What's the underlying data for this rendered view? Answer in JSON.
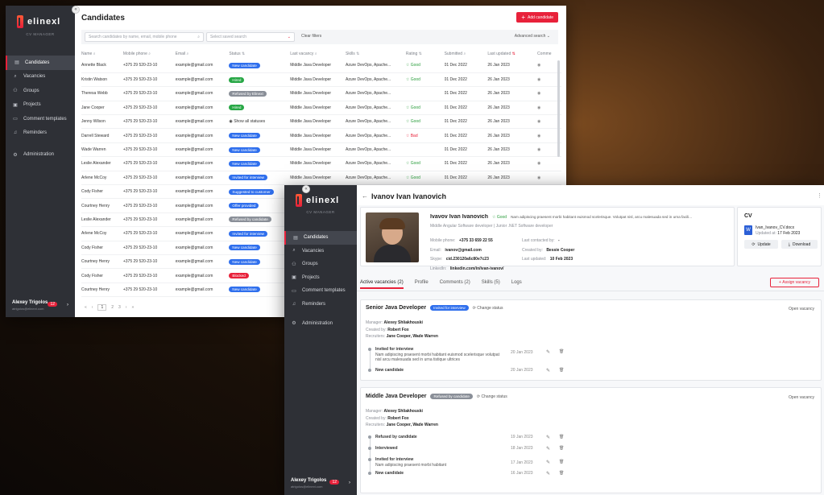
{
  "app": {
    "brand": "elinexl",
    "brand_sub": "CV MANAGER"
  },
  "nav": [
    {
      "label": "Candidates",
      "icon": "file-icon"
    },
    {
      "label": "Vacancies",
      "icon": "search-icon"
    },
    {
      "label": "Groups",
      "icon": "users-icon"
    },
    {
      "label": "Projects",
      "icon": "briefcase-icon"
    },
    {
      "label": "Comment templates",
      "icon": "comment-icon"
    },
    {
      "label": "Reminders",
      "icon": "bell-icon"
    }
  ],
  "admin_label": "Administration",
  "user": {
    "name": "Alexey Trigolos",
    "email": "atrigolos@elinext.com",
    "count": "12"
  },
  "list": {
    "title": "Candidates",
    "add_label": "Add candidate",
    "search_placeholder": "Search candidates by name, email, mobile phone",
    "saved_placeholder": "Select saved search",
    "clear_label": "Clear filters",
    "advanced_label": "Advanced search",
    "columns": [
      "Name",
      "Mobile phone",
      "Email",
      "Status",
      "Last vacancy",
      "Skills",
      "Rating",
      "Submitted",
      "Last updated",
      "Comme"
    ],
    "rows": [
      {
        "name": "Annette Black",
        "phone": "+375 29 520-23-10",
        "email": "example@gmail.com",
        "status": "New candidate",
        "color": "#2f6fed",
        "vac": "Middle Java Developer",
        "skills": "Azure DevOps,  Apache...",
        "rating": "Good",
        "submitted": "01 Dec 2022",
        "updated": "26 Jan 2023"
      },
      {
        "name": "Kristin Watson",
        "phone": "+375 29 520-23-10",
        "email": "example@gmail.com",
        "status": "Hired",
        "color": "#27a745",
        "vac": "Middle Java Developer",
        "skills": "Azure DevOps,  Apache...",
        "rating": "Good",
        "submitted": "01 Dec 2022",
        "updated": "26 Jan 2023"
      },
      {
        "name": "Theresa Webb",
        "phone": "+375 29 520-23-10",
        "email": "example@gmail.com",
        "status": "Refused by Elinext",
        "color": "#8a8f98",
        "vac": "Middle Java Developer",
        "skills": "Azure DevOps,  Apache...",
        "rating": "",
        "submitted": "01 Dec 2022",
        "updated": "26 Jan 2023"
      },
      {
        "name": "Jane Cooper",
        "phone": "+375 29 520-23-10",
        "email": "example@gmail.com",
        "status": "Hired",
        "color": "#27a745",
        "vac": "Middle Java Developer",
        "skills": "Azure DevOps,  Apache...",
        "rating": "Good",
        "submitted": "01 Dec 2022",
        "updated": "26 Jan 2023"
      },
      {
        "name": "Jenny Wilson",
        "phone": "+375 29 520-23-10",
        "email": "example@gmail.com",
        "status": "Show all statuses",
        "color": "",
        "vac": "Middle Java Developer",
        "skills": "Azure DevOps,  Apache...",
        "rating": "Good",
        "submitted": "01 Dec 2022",
        "updated": "26 Jan 2023"
      },
      {
        "name": "Darrell Steward",
        "phone": "+375 29 520-23-10",
        "email": "example@gmail.com",
        "status": "New candidate",
        "color": "#2f6fed",
        "vac": "Middle Java Developer",
        "skills": "Azure DevOps,  Apache...",
        "rating": "Bad",
        "submitted": "01 Dec 2022",
        "updated": "26 Jan 2023"
      },
      {
        "name": "Wade Warren",
        "phone": "+375 29 520-23-10",
        "email": "example@gmail.com",
        "status": "New candidate",
        "color": "#2f6fed",
        "vac": "Middle Java Developer",
        "skills": "Azure DevOps,  Apache...",
        "rating": "",
        "submitted": "01 Dec 2022",
        "updated": "26 Jan 2023"
      },
      {
        "name": "Leslie Alexander",
        "phone": "+375 29 520-23-10",
        "email": "example@gmail.com",
        "status": "New candidate",
        "color": "#2f6fed",
        "vac": "Middle Java Developer",
        "skills": "Azure DevOps,  Apache...",
        "rating": "Good",
        "submitted": "01 Dec 2022",
        "updated": "26 Jan 2023"
      },
      {
        "name": "Arlene McCoy",
        "phone": "+375 29 520-23-10",
        "email": "example@gmail.com",
        "status": "Invited for interview",
        "color": "#2f6fed",
        "vac": "Middle Java Developer",
        "skills": "Azure DevOps,  Apache...",
        "rating": "Good",
        "submitted": "01 Dec 2022",
        "updated": "26 Jan 2023"
      },
      {
        "name": "Cody Fisher",
        "phone": "+375 29 520-23-10",
        "email": "example@gmail.com",
        "status": "Suggested to customer",
        "color": "#2f6fed",
        "vac": "",
        "skills": "",
        "rating": "",
        "submitted": "",
        "updated": ""
      },
      {
        "name": "Courtney Henry",
        "phone": "+375 29 520-23-10",
        "email": "example@gmail.com",
        "status": "Offer provided",
        "color": "#2f6fed",
        "vac": "",
        "skills": "",
        "rating": "",
        "submitted": "",
        "updated": ""
      },
      {
        "name": "Leslie Alexander",
        "phone": "+375 29 520-23-10",
        "email": "example@gmail.com",
        "status": "Refused by candidate",
        "color": "#8a8f98",
        "vac": "",
        "skills": "",
        "rating": "",
        "submitted": "",
        "updated": ""
      },
      {
        "name": "Arlene McCoy",
        "phone": "+375 29 520-23-10",
        "email": "example@gmail.com",
        "status": "Invited for interview",
        "color": "#2f6fed",
        "vac": "",
        "skills": "",
        "rating": "",
        "submitted": "",
        "updated": ""
      },
      {
        "name": "Cody Fisher",
        "phone": "+375 29 520-23-10",
        "email": "example@gmail.com",
        "status": "New candidate",
        "color": "#2f6fed",
        "vac": "",
        "skills": "",
        "rating": "",
        "submitted": "",
        "updated": ""
      },
      {
        "name": "Courtney Henry",
        "phone": "+375 29 520-23-10",
        "email": "example@gmail.com",
        "status": "New candidate",
        "color": "#2f6fed",
        "vac": "",
        "skills": "",
        "rating": "",
        "submitted": "",
        "updated": ""
      },
      {
        "name": "Cody Fisher",
        "phone": "+375 29 520-23-10",
        "email": "example@gmail.com",
        "status": "Blocked",
        "color": "#e8213a",
        "vac": "",
        "skills": "",
        "rating": "",
        "submitted": "",
        "updated": ""
      },
      {
        "name": "Courtney Henry",
        "phone": "+375 29 520-23-10",
        "email": "example@gmail.com",
        "status": "New candidate",
        "color": "#2f6fed",
        "vac": "",
        "skills": "",
        "rating": "",
        "submitted": "",
        "updated": ""
      }
    ],
    "pager": [
      "«",
      "‹",
      "1",
      "2",
      "3",
      "›",
      "»"
    ]
  },
  "profile": {
    "title": "Ivanov Ivan Ivanovich",
    "name": "Ivavov Ivan Ivanovich",
    "rating": "Good",
    "summary": "Nam adipiscing praesent morbi habitant euismod scelerisque. Volutpat nisl, arcu malesuada sed in urna facili...",
    "role": "Middle Angular Software developer  |  Junior .NET Software developer",
    "phone_label": "Mobile phone:",
    "phone": "+375 33 659 22 55",
    "email_label": "Email:",
    "email": "ivanov@gmail.com",
    "skype_label": "Skype:",
    "skype": "cid.230120a6c80e7c23",
    "linkedin_label": "LinkedIn:",
    "linkedin": "linkedin.com/in/ivan-ivanov/",
    "contacted_label": "Last contacted by:",
    "contacted": "-",
    "created_label": "Created by:",
    "created": "Bessie Cooper",
    "updated_label": "Last updated:",
    "updated": "10 Feb 2023",
    "cv_title": "CV",
    "cv_file": "Ivan_Ivanov_CV.docx",
    "cv_updated_label": "Updated at:",
    "cv_updated": "17 Feb 2023",
    "cv_update": "Update",
    "cv_download": "Download",
    "tabs": [
      "Active vacancies (2)",
      "Profile",
      "Comments (2)",
      "Skills (5)",
      "Logs"
    ],
    "assign": "Assign vacancy",
    "vac1": {
      "title": "Senior Java Developer",
      "status": "Invited for interview",
      "change": "Change status",
      "open": "Open vacancy",
      "manager_label": "Manager:",
      "manager": "Alexey Shliakhouski",
      "created_label": "Created by:",
      "created": "Robert Fox",
      "recruiters_label": "Recruiters:",
      "recruiters": "Jane Cooper, Wade Warren",
      "steps": [
        {
          "title": "Invited for interview",
          "text": "Nam adipiscing praesent morbi habitant euismod scelerisque volutpat nisl arcu malesuada sed in urna tistique ultrices",
          "date": "20 Jan 2023"
        },
        {
          "title": "New candidate",
          "text": "",
          "date": "20 Jan 2023"
        }
      ]
    },
    "vac2": {
      "title": "Middle Java Developer",
      "status": "Refused by candidate",
      "change": "Change status",
      "open": "Open vacancy",
      "manager_label": "Manager:",
      "manager": "Alexey Shliakhouski",
      "created_label": "Created by:",
      "created": "Robert Fox",
      "recruiters_label": "Recruiters:",
      "recruiters": "Jane Cooper, Wade Warren",
      "steps": [
        {
          "title": "Refused by candidate",
          "text": "",
          "date": "19 Jan 2023"
        },
        {
          "title": "Interviewed",
          "text": "",
          "date": "18 Jan 2023"
        },
        {
          "title": "Invited for interview",
          "text": "Nam adipiscing praesent morbi habitant",
          "date": "17 Jan 2023"
        },
        {
          "title": "New candidate",
          "text": "",
          "date": "16 Jan 2023"
        }
      ]
    }
  },
  "colors": {
    "accent": "#e8213a",
    "sidebar": "#2e3036",
    "blue": "#2f6fed",
    "green": "#27a745"
  }
}
